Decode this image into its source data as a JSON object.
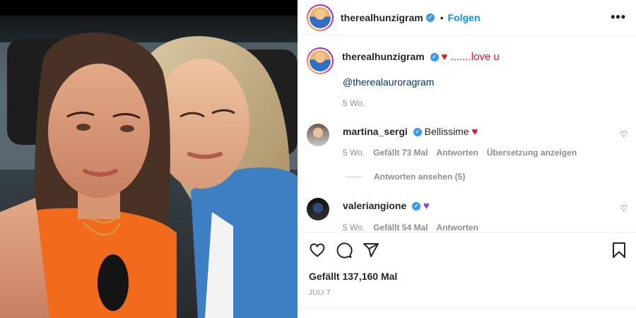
{
  "post": {
    "author": "therealhunzigram",
    "follow_label": "Folgen",
    "more_label": "•••",
    "caption": "♥ .......love u",
    "mention": "@therealauroragram",
    "caption_age": "5 Wo."
  },
  "comments": [
    {
      "user": "martina_sergi",
      "text": "Bellissime",
      "emoji": "♥",
      "age": "5 Wo.",
      "likes": "Gefällt 73 Mal",
      "reply_label": "Antworten",
      "translate_label": "Übersetzung anzeigen",
      "view_replies": "Antworten ansehen (5)"
    },
    {
      "user": "valeriangione",
      "emoji": "♥",
      "age": "5 Wo.",
      "likes": "Gefällt 54 Mal",
      "reply_label": "Antworten"
    }
  ],
  "footer": {
    "likes": "Gefällt 137,160 Mal",
    "date": "JULI 7"
  },
  "colors": {
    "link": "#0095f6",
    "verified": "#3897f0",
    "muted": "#8e8e8e",
    "heart": "#e0142b"
  },
  "icons": [
    "verified-icon",
    "more-icon",
    "heart-icon",
    "comment-icon",
    "share-icon",
    "bookmark-icon"
  ]
}
